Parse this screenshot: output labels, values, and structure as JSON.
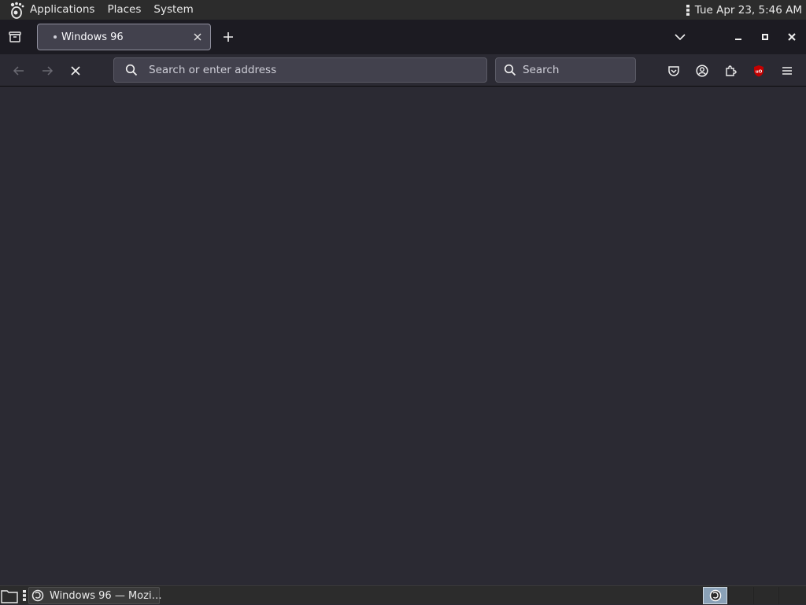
{
  "top_panel": {
    "menus": [
      "Applications",
      "Places",
      "System"
    ],
    "clock": "Tue Apr 23,  5:46 AM"
  },
  "browser": {
    "tab": {
      "title": "Windows 96"
    },
    "urlbar": {
      "placeholder": "Search or enter address"
    },
    "searchbar": {
      "placeholder": "Search"
    }
  },
  "taskbar": {
    "task_label": "Windows 96 — Mozi…"
  },
  "colors": {
    "panel_bg": "#2c2c2c",
    "tabstrip_bg": "#1c1b22",
    "toolbar_bg": "#2b2a33",
    "field_bg": "#42414d",
    "ublock_red": "#c30000",
    "workspace_active": "#8aa1b7"
  },
  "icons": {
    "top_panel": [
      "gnome-foot-icon",
      "panel-overflow-icon"
    ],
    "tab_strip": [
      "tabs-overview-icon",
      "close-tab-icon",
      "new-tab-icon",
      "chevron-down-icon",
      "minimize-icon",
      "maximize-icon",
      "close-window-icon"
    ],
    "nav_bar": [
      "back-arrow-icon",
      "forward-arrow-icon",
      "stop-loading-icon",
      "search-icon",
      "pocket-icon",
      "account-icon",
      "extensions-icon",
      "ublock-origin-icon",
      "hamburger-menu-icon"
    ],
    "bottom_panel": [
      "show-desktop-icon",
      "firefox-icon"
    ]
  }
}
